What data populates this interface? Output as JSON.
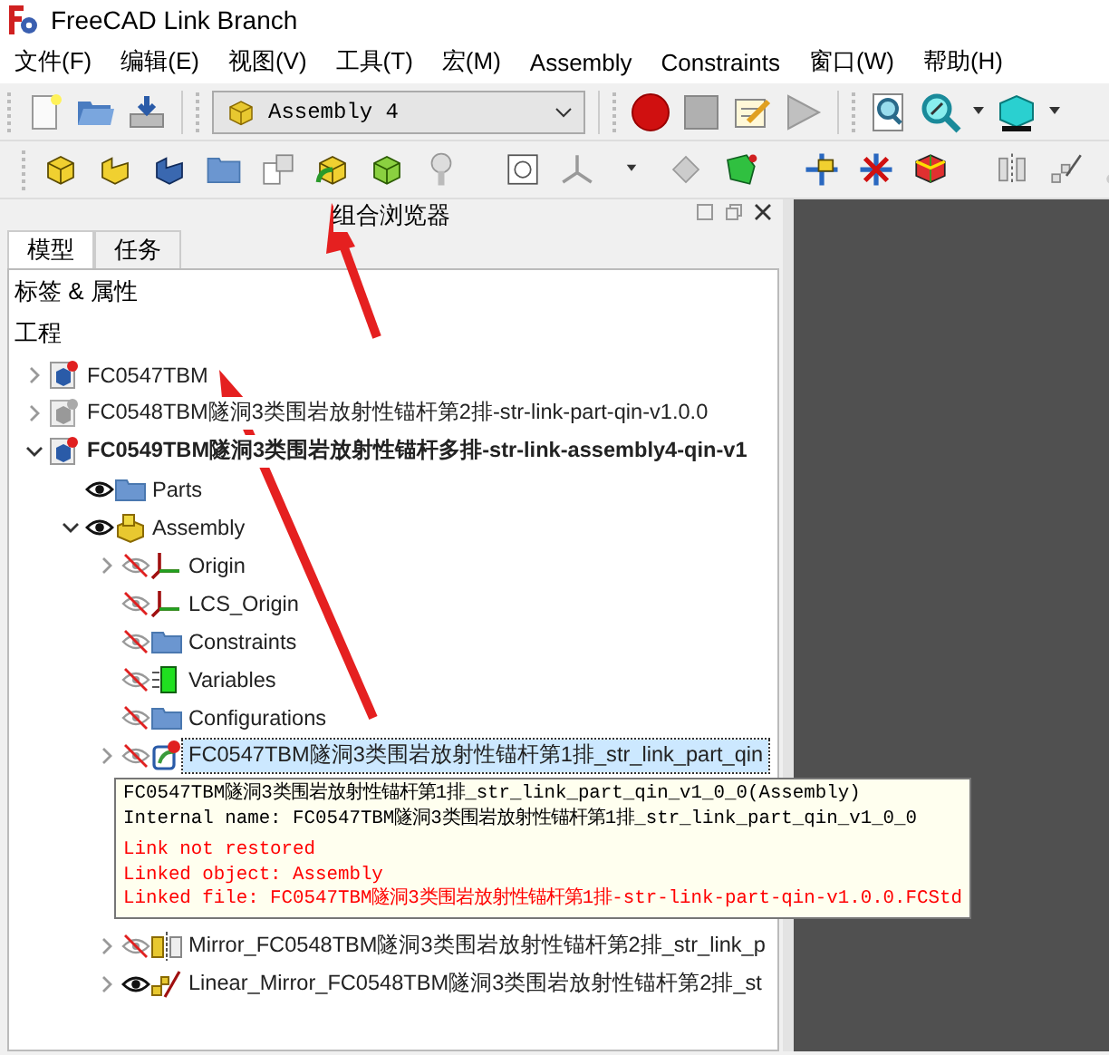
{
  "window": {
    "title": "FreeCAD Link Branch"
  },
  "menu": [
    "文件(F)",
    "编辑(E)",
    "视图(V)",
    "工具(T)",
    "宏(M)",
    "Assembly",
    "Constraints",
    "窗口(W)",
    "帮助(H)"
  ],
  "workbench": {
    "value": "Assembly 4"
  },
  "panel": {
    "title": "组合浏览器"
  },
  "tabs": [
    {
      "label": "模型",
      "selected": true
    },
    {
      "label": "任务",
      "selected": false
    }
  ],
  "tree": {
    "header": "标签 & 属性",
    "section": "工程",
    "items": [
      {
        "label": "FC0547TBM",
        "kind": "doc",
        "bold": false,
        "selected": false,
        "expanded": false
      },
      {
        "label": "FC0548TBM隧洞3类围岩放射性锚杆第2排-str-link-part-qin-v1.0.0",
        "kind": "doc_inactive",
        "bold": false,
        "selected": false,
        "expanded": false
      },
      {
        "label": "FC0549TBM隧洞3类围岩放射性锚杆多排-str-link-assembly4-qin-v1",
        "kind": "doc",
        "bold": true,
        "selected": false,
        "expanded": true,
        "children": [
          {
            "label": "Parts",
            "kind": "folder",
            "visible": true,
            "bold": false,
            "selected": false
          },
          {
            "label": "Assembly",
            "kind": "assembly",
            "visible": true,
            "bold": false,
            "selected": false,
            "expanded": true,
            "children": [
              {
                "label": "Origin",
                "kind": "axes",
                "visible": false,
                "bold": false,
                "selected": false,
                "expanded": false
              },
              {
                "label": "LCS_Origin",
                "kind": "axes",
                "visible": false,
                "bold": false,
                "selected": false
              },
              {
                "label": "Constraints",
                "kind": "folder",
                "visible": false,
                "bold": false,
                "selected": false
              },
              {
                "label": "Variables",
                "kind": "variables",
                "visible": false,
                "bold": false,
                "selected": false
              },
              {
                "label": "Configurations",
                "kind": "folder",
                "visible": false,
                "bold": false,
                "selected": false
              },
              {
                "label": "FC0547TBM隧洞3类围岩放射性锚杆第1排_str_link_part_qin",
                "kind": "link",
                "visible": false,
                "bold": false,
                "selected": true,
                "expanded": false,
                "tooltip": [
                  {
                    "text": "FC0547TBM隧洞3类围岩放射性锚杆第1排_str_link_part_qin_v1_0_0(Assembly)",
                    "kind": "info"
                  },
                  {
                    "text": "Internal name: FC0547TBM隧洞3类围岩放射性锚杆第1排_str_link_part_qin_v1_0_0",
                    "kind": "info"
                  },
                  {
                    "text": "Link not restored",
                    "kind": "error"
                  },
                  {
                    "text": "Linked object: Assembly",
                    "kind": "error"
                  },
                  {
                    "text": "Linked file: FC0547TBM隧洞3类围岩放射性锚杆第1排-str-link-part-qin-v1.0.0.FCStd",
                    "kind": "error"
                  }
                ]
              },
              {
                "label": "Mirror_FC0548TBM隧洞3类围岩放射性锚杆第2排_str_link_p",
                "kind": "mirror",
                "visible": false,
                "bold": false,
                "selected": false,
                "expanded": false
              },
              {
                "label": "Linear_Mirror_FC0548TBM隧洞3类围岩放射性锚杆第2排_st",
                "kind": "pattern",
                "visible": true,
                "bold": false,
                "selected": false,
                "expanded": false
              }
            ]
          }
        ]
      }
    ]
  }
}
